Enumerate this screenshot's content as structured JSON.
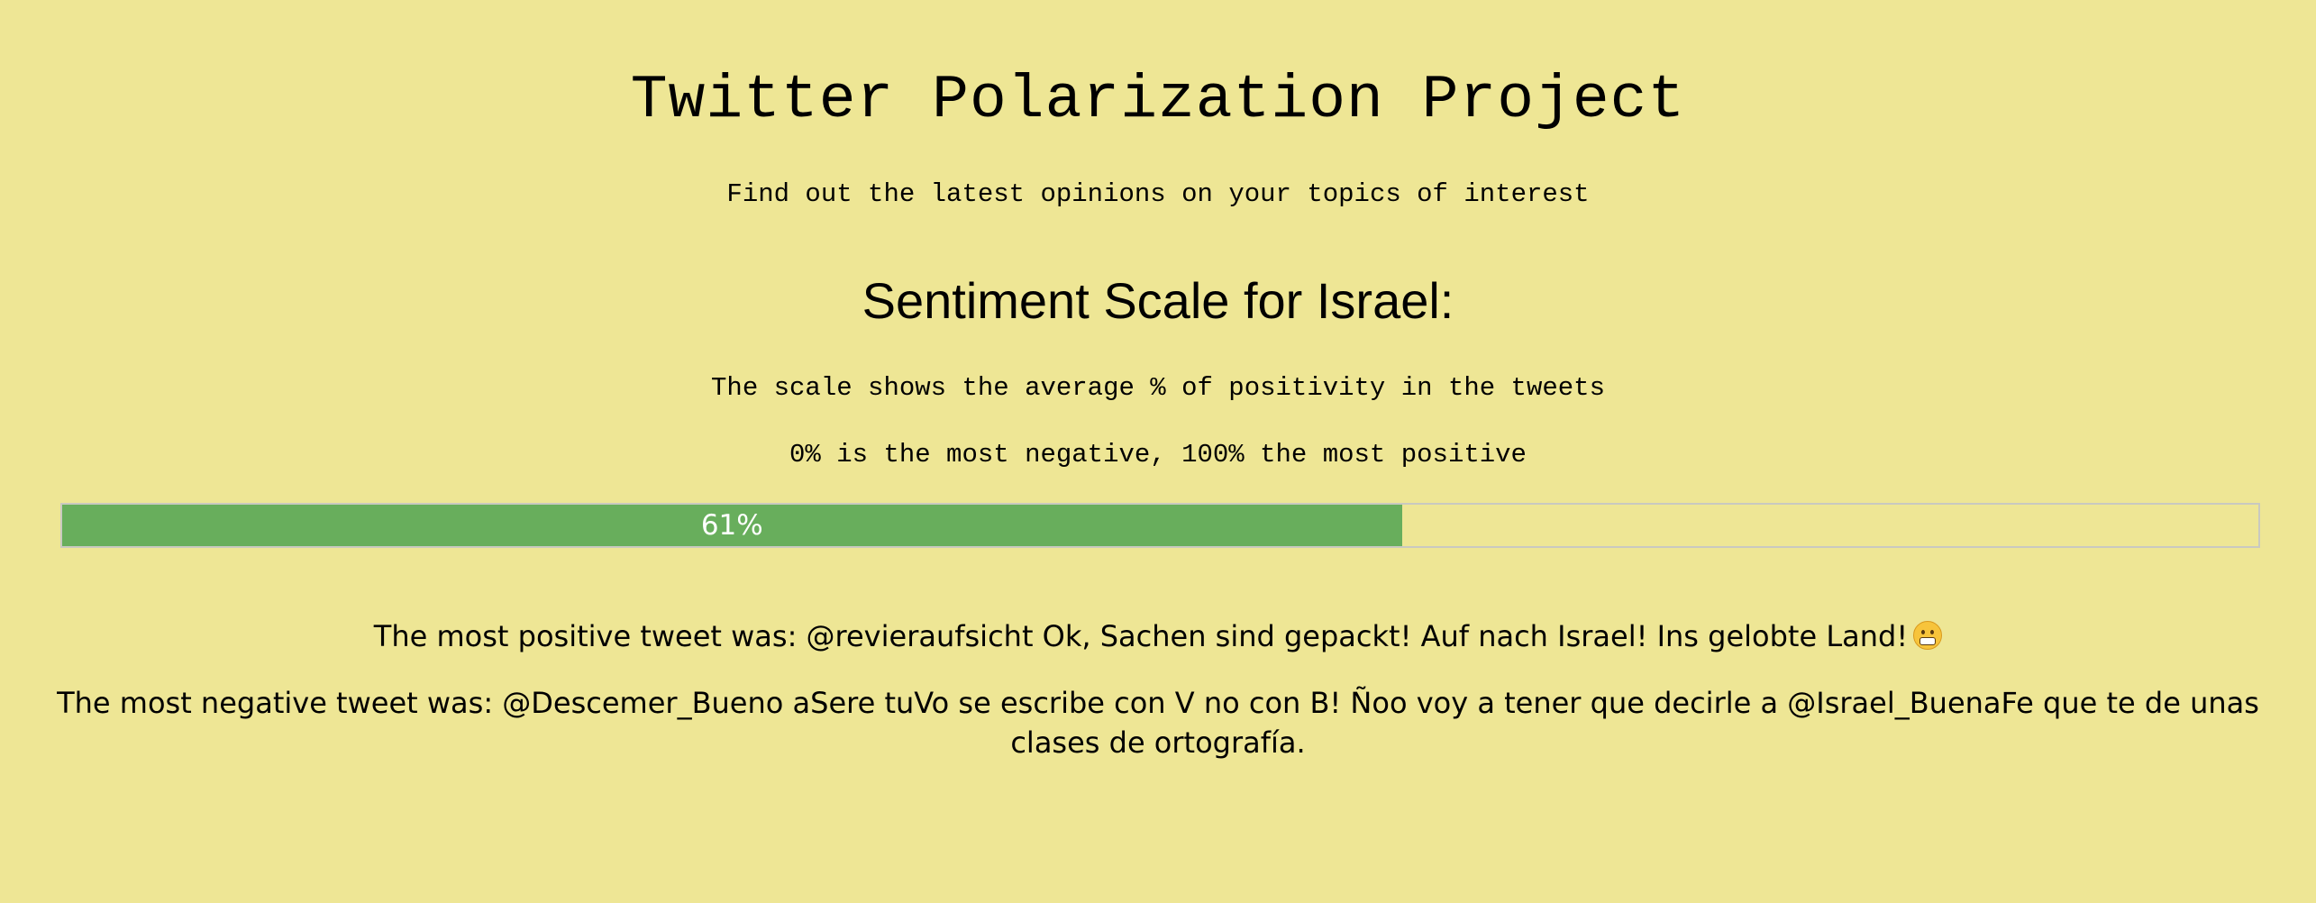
{
  "header": {
    "title": "Twitter Polarization Project",
    "subtitle": "Find out the latest opinions on your topics of interest"
  },
  "sentiment": {
    "heading": "Sentiment Scale for Israel:",
    "note_1": "The scale shows the average % of positivity in the tweets",
    "note_2": "0% is the most negative, 100% the most positive",
    "percent_label": "61%",
    "percent_value": 61,
    "fill_color": "#68ae5c"
  },
  "tweets": {
    "positive": "The most positive tweet was: @revieraufsicht Ok, Sachen sind gepackt! Auf nach Israel! Ins gelobte Land!",
    "positive_emoji": "grimacing-face-icon",
    "negative": "The most negative tweet was: @Descemer_Bueno aSere tuVo se escribe con V no con B! Ñoo voy a tener que decirle a @Israel_BuenaFe que te de unas clases de ortografía."
  },
  "colors": {
    "background": "#eee695",
    "bar_fill": "#68ae5c",
    "bar_border": "#c9c9c0"
  }
}
